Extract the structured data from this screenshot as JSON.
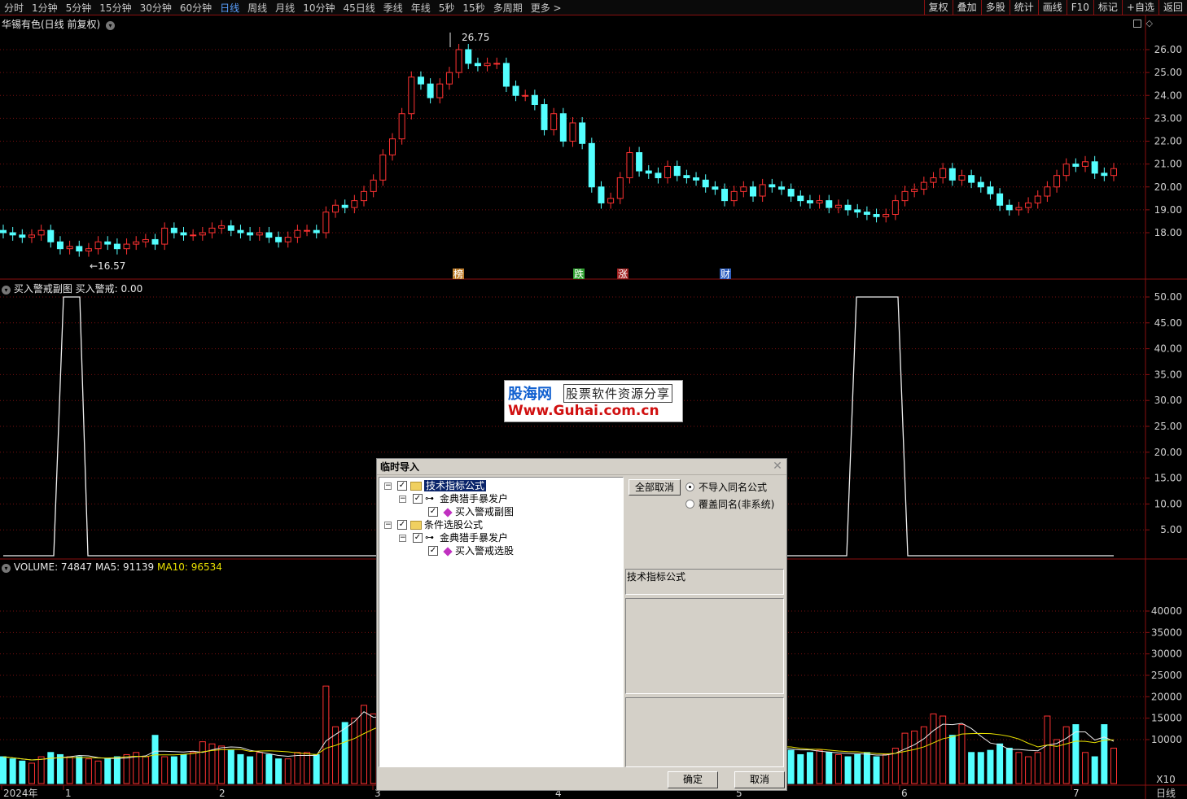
{
  "topbar": {
    "periods": [
      "分时",
      "1分钟",
      "5分钟",
      "15分钟",
      "30分钟",
      "60分钟",
      "日线",
      "周线",
      "月线",
      "10分钟",
      "45日线",
      "季线",
      "年线",
      "5秒",
      "15秒",
      "多周期",
      "更多 >"
    ],
    "active": "日线",
    "tools": [
      "复权",
      "叠加",
      "多股",
      "统计",
      "画线",
      "F10",
      "标记",
      "+自选",
      "返回"
    ]
  },
  "main": {
    "title": "华锡有色(日线 前复权)",
    "y_ticks": [
      "26.00",
      "25.00",
      "24.00",
      "23.00",
      "22.00",
      "21.00",
      "20.00",
      "19.00",
      "18.00"
    ],
    "high_label": "26.75",
    "low_label": "16.57",
    "markers": [
      "榜",
      "跌",
      "涨",
      "财"
    ]
  },
  "sub": {
    "title": "买入警戒副图",
    "value_label": "买入警戒: 0.00",
    "y_ticks": [
      "50.00",
      "45.00",
      "40.00",
      "35.00",
      "30.00",
      "25.00",
      "20.00",
      "15.00",
      "10.00",
      "5.00"
    ]
  },
  "vol": {
    "label": "VOLUME: 74847",
    "ma5": "MA5: 91139",
    "ma10": "MA10: 96534",
    "y_ticks": [
      "40000",
      "35000",
      "30000",
      "25000",
      "20000",
      "15000",
      "10000"
    ],
    "unit": "X10"
  },
  "xaxis": {
    "labels": [
      "2024年",
      "1",
      "2",
      "3",
      "4",
      "5",
      "6",
      "7"
    ],
    "period": "日线"
  },
  "watermark": {
    "l1": "股海网",
    "l1b": "股票软件资源分享",
    "l2": "Www.Guhai.com.cn"
  },
  "dialog": {
    "title": "临时导入",
    "tree": {
      "n1": "技术指标公式",
      "n2": "金典猎手暴发户",
      "n3": "买入警戒副图",
      "n4": "条件选股公式",
      "n5": "金典猎手暴发户",
      "n6": "买入警戒选股"
    },
    "cancel_all": "全部取消",
    "opt1": "不导入同名公式",
    "opt2": "覆盖同名(非系统)",
    "type_label": "技术指标公式",
    "ok": "确定",
    "cancel": "取消"
  },
  "chart_data": [
    {
      "type": "candlestick",
      "title": "华锡有色(日线 前复权)",
      "ylim": [
        17.2,
        27.0
      ],
      "high": 26.75,
      "low": 16.57
    },
    {
      "type": "line",
      "title": "买入警戒副图",
      "ylim": [
        0,
        50
      ],
      "values": [
        0,
        0,
        0,
        50,
        50,
        0,
        0,
        0,
        0,
        0,
        0,
        0,
        0,
        0,
        0,
        0,
        0,
        0,
        0,
        0,
        0,
        0,
        0,
        0,
        0,
        0,
        0,
        0,
        0,
        0,
        0,
        0,
        0,
        0,
        0,
        0,
        0,
        0,
        0,
        0,
        0,
        50,
        50,
        50,
        0,
        0,
        0,
        0,
        0,
        0,
        0,
        0,
        0,
        0
      ]
    },
    {
      "type": "bar",
      "title": "VOLUME",
      "ylim": [
        0,
        45000
      ]
    }
  ]
}
